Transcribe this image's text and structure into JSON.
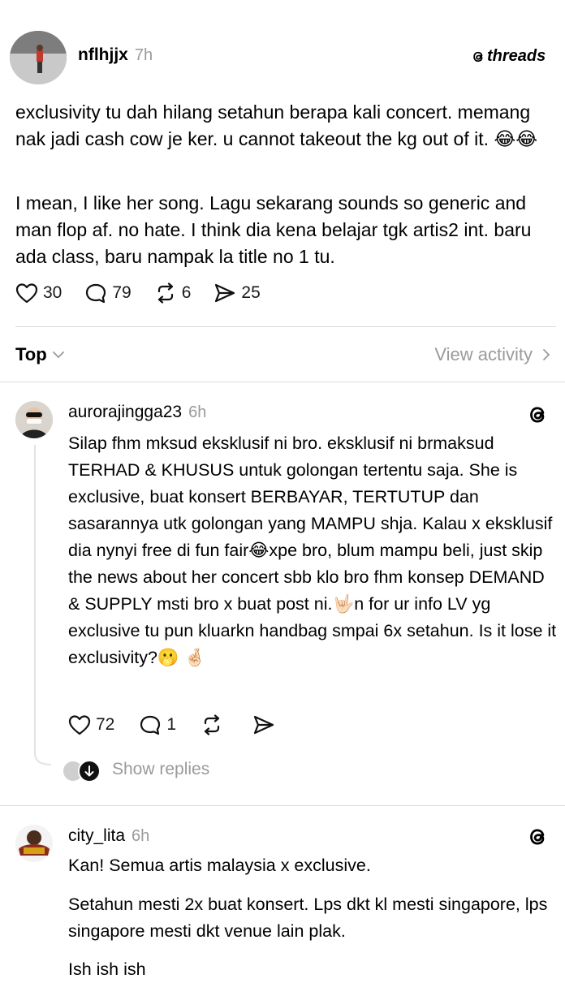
{
  "post": {
    "username": "nflhjjx",
    "time": "7h",
    "brand": "threads",
    "paragraph1": "exclusivity tu dah hilang setahun berapa kali concert. memang nak jadi cash cow je ker. u cannot takeout the kg out of it. 😂😂",
    "paragraph2": "I mean, I like her song. Lagu sekarang sounds so generic and man flop af. no hate. I think dia kena belajar tgk artis2 int. baru ada class, baru nampak la title no 1 tu.",
    "likes": "30",
    "comments": "79",
    "reposts": "6",
    "shares": "25"
  },
  "sort": {
    "label": "Top",
    "view_activity": "View activity"
  },
  "replies": [
    {
      "username": "aurorajingga23",
      "time": "6h",
      "text": "Silap fhm mksud eksklusif ni bro. eksklusif ni brmaksud TERHAD & KHUSUS untuk golongan tertentu saja. She is exclusive, buat konsert BERBAYAR, TERTUTUP dan sasarannya utk golongan yang MAMPU shja. Kalau x eksklusif dia nynyi free di fun fair😂xpe bro, blum mampu beli, just skip the news about her concert sbb klo bro fhm konsep DEMAND & SUPPLY msti bro x buat post ni.🤟🏻n for ur info LV yg exclusive tu pun kluarkn handbag smpai 6x setahun. Is it lose it exclusivity?🫢 🤞🏻",
      "likes": "72",
      "comments": "1",
      "show_replies": "Show replies"
    },
    {
      "username": "city_lita",
      "time": "6h",
      "paragraph1": "Kan! Semua artis malaysia x exclusive.",
      "paragraph2": "Setahun mesti 2x buat konsert. Lps dkt kl mesti singapore, lps singapore mesti dkt venue lain plak.",
      "paragraph3": "Ish ish ish"
    }
  ]
}
